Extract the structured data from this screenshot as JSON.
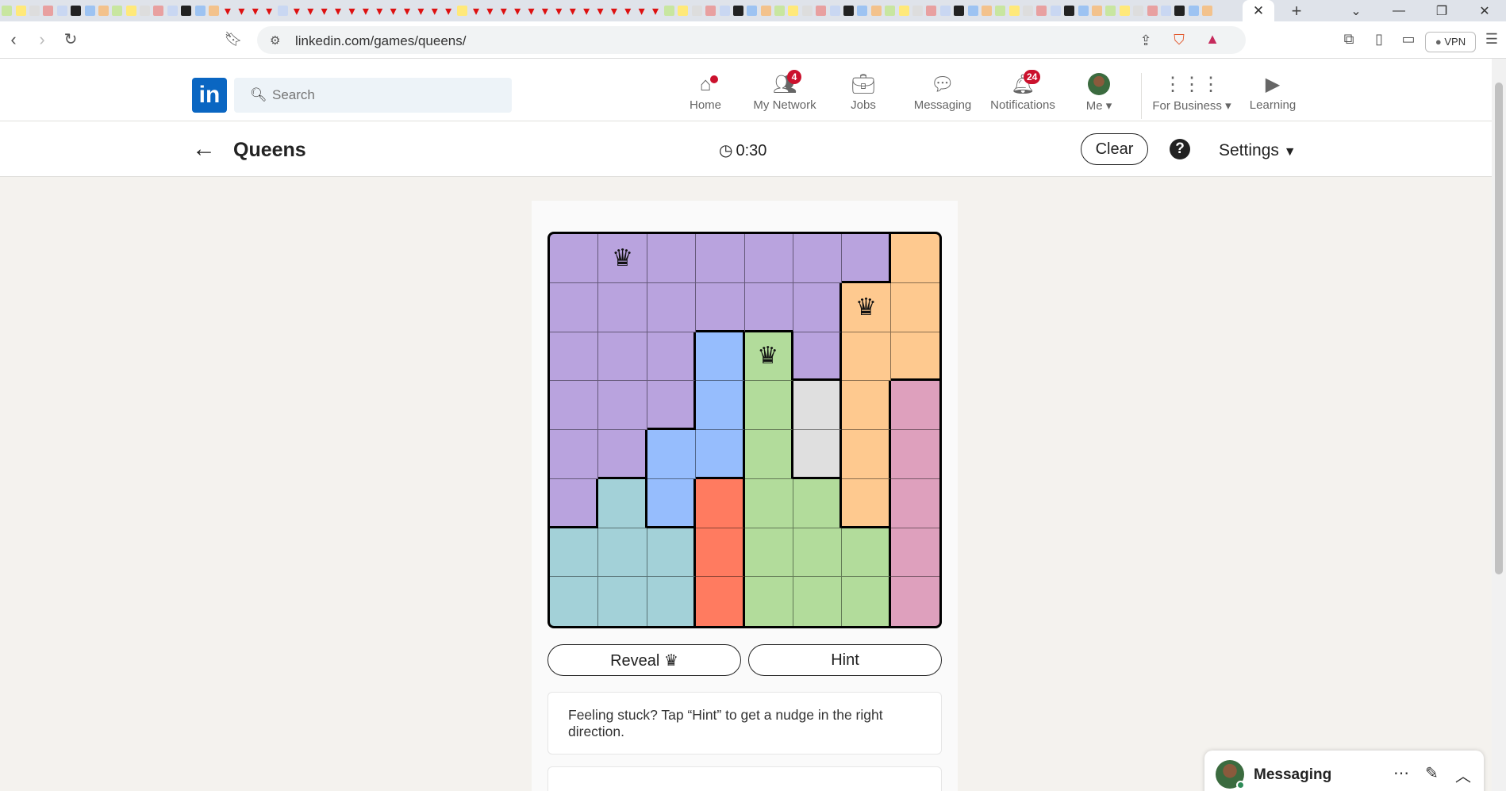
{
  "browser": {
    "url": "linkedin.com/games/queens/",
    "vpn_label": "VPN",
    "tab_close": "✕",
    "new_tab": "+",
    "window_controls": [
      "⌄",
      "—",
      "❐",
      "✕"
    ]
  },
  "header": {
    "logo": "in",
    "search_placeholder": "Search",
    "nav": {
      "home": "Home",
      "network": "My Network",
      "network_badge": "4",
      "jobs": "Jobs",
      "messaging": "Messaging",
      "notifications": "Notifications",
      "notifications_badge": "24",
      "me": "Me",
      "business": "For Business",
      "learning": "Learning"
    }
  },
  "game": {
    "back": "←",
    "title": "Queens",
    "timer": "0:30",
    "clear": "Clear",
    "help": "?",
    "settings": "Settings",
    "reveal": "Reveal",
    "hint": "Hint",
    "tip": "Feeling stuck? Tap “Hint” to get a nudge in the right direction.",
    "colors": {
      "P": "#b9a3de",
      "O": "#fec98f",
      "B": "#96bdfd",
      "G": "#b2dc9b",
      "W": "#dfdfdf",
      "K": "#dea0bd",
      "T": "#a3d1d8",
      "R": "#ff7b60"
    },
    "grid": [
      "PPPPPPPO",
      "PPPPPPOO",
      "PPPBGPOO",
      "PPPBGWOK",
      "PPBBGWOK",
      "PTBRGGOK",
      "TTTRGGGK",
      "TTTRGGGK"
    ],
    "queens": [
      [
        0,
        1
      ],
      [
        1,
        6
      ],
      [
        2,
        4
      ]
    ]
  },
  "messaging": {
    "title": "Messaging"
  }
}
